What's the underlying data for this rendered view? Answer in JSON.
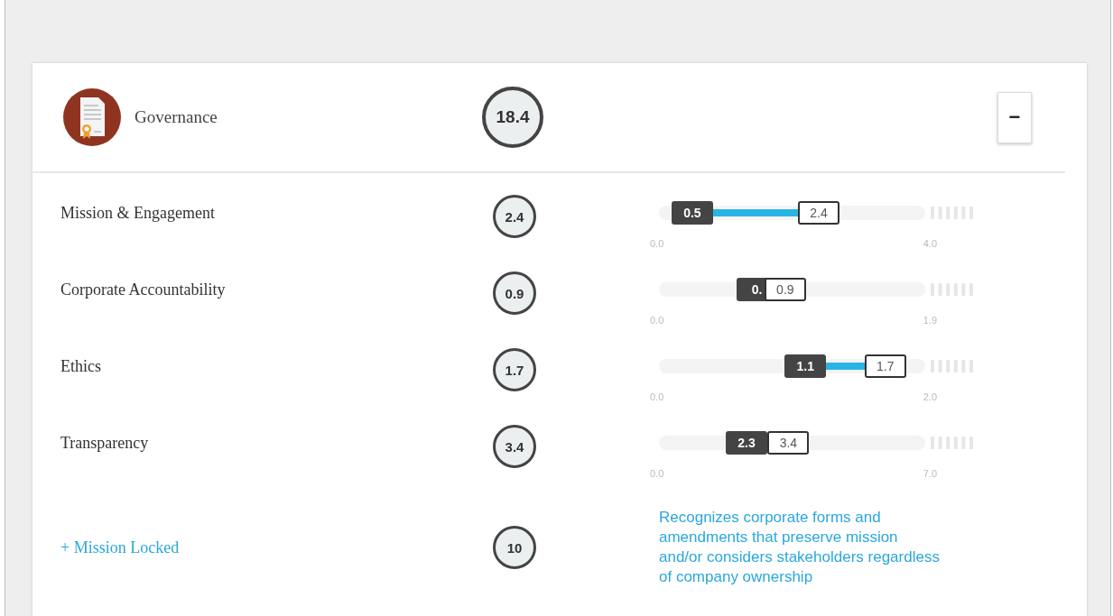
{
  "section": {
    "title": "Governance",
    "score": "18.4",
    "toggle": "−"
  },
  "metrics": [
    {
      "kind": "range",
      "label": "Mission & Engagement",
      "score": "2.4",
      "low": {
        "label": "0.5",
        "level": 0.125
      },
      "high": {
        "label": "2.4",
        "level": 0.6
      },
      "axis_min": "0.0",
      "axis_max": "4.0"
    },
    {
      "kind": "range",
      "label": "Corporate Accountability",
      "score": "0.9",
      "low": {
        "label": "0.",
        "level": 0.368
      },
      "high": {
        "label": "0.9",
        "level": 0.474
      },
      "axis_min": "0.0",
      "axis_max": "1.9"
    },
    {
      "kind": "range",
      "label": "Ethics",
      "score": "1.7",
      "low": {
        "label": "1.1",
        "level": 0.55
      },
      "high": {
        "label": "1.7",
        "level": 0.85
      },
      "axis_min": "0.0",
      "axis_max": "2.0"
    },
    {
      "kind": "range",
      "label": "Transparency",
      "score": "3.4",
      "low": {
        "label": "2.3",
        "level": 0.329
      },
      "high": {
        "label": "3.4",
        "level": 0.486
      },
      "axis_min": "0.0",
      "axis_max": "7.0"
    },
    {
      "kind": "note",
      "label": "+ Mission Locked",
      "score": "10",
      "description": "Recognizes corporate forms and amendments that preserve mission and/or considers stakeholders regardless of company ownership"
    }
  ]
}
